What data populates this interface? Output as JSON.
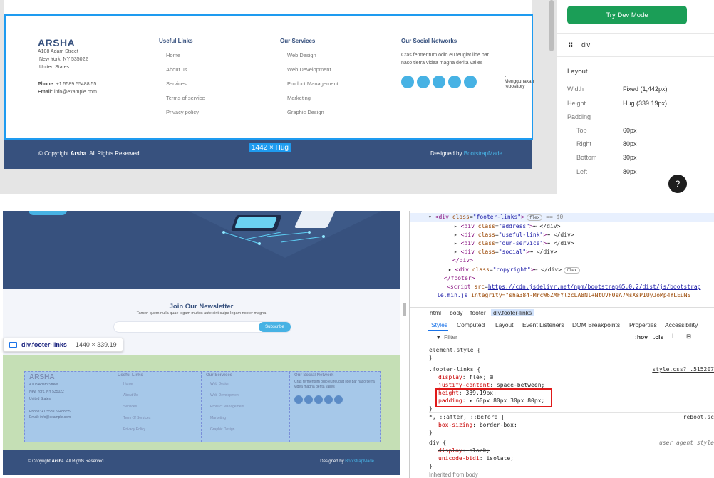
{
  "top_preview": {
    "brand": "ARSHA",
    "address_lines": [
      "A108 Adam Street",
      "New York, NY 535022",
      "United States"
    ],
    "phone_label": "Phone:",
    "phone": "+1 5589 55488 55",
    "email_label": "Email:",
    "email": "info@example.com",
    "useful_links_title": "Useful Links",
    "useful_links": [
      "Home",
      "About us",
      "Services",
      "Terms of service",
      "Privacy policy"
    ],
    "services_title": "Our Services",
    "services": [
      "Web Design",
      "Web Development",
      "Product Management",
      "Marketing",
      "Graphic Design"
    ],
    "social_title": "Our Social Networks",
    "social_text": "Cras fermentum odio eu feugiat lide par naso tierra videa magna derita valies",
    "repo_text": "- Menggunakan repository",
    "copyright_prefix": "© Copyright ",
    "copyright_brand": "Arsha",
    "copyright_suffix": ". All Rights Reserved",
    "designed_by": "Designed by ",
    "designer": "BootstrapMade",
    "size_badge": "1442 × Hug"
  },
  "props_panel": {
    "dev_mode_button": "Try Dev Mode",
    "frame_icon": "⁞⁞",
    "element_label": "div",
    "layout_title": "Layout",
    "rows": [
      {
        "label": "Width",
        "value": "Fixed (1,442px)"
      },
      {
        "label": "Height",
        "value": "Hug (339.19px)"
      },
      {
        "label": "Padding",
        "value": ""
      },
      {
        "label": "Top",
        "value": "60px"
      },
      {
        "label": "Right",
        "value": "80px"
      },
      {
        "label": "Bottom",
        "value": "30px"
      },
      {
        "label": "Left",
        "value": "80px"
      }
    ],
    "help": "?"
  },
  "bottom_preview": {
    "newsletter_title": "Join Our Newsletter",
    "newsletter_sub": "Tamen quem nulla quae legam multos aute sint culpa legam noster magna",
    "subscribe_button": "Subscribe",
    "tooltip_tag": "div.footer-links",
    "tooltip_dims": "1440 × 339.19",
    "hl_brand": "ARSHA",
    "hl_address": [
      "A108 Adam Street",
      "New York, NY 535022",
      "United States"
    ],
    "hl_phone": "Phone: +1 5589 55488 55",
    "hl_email": "Email: info@example.com",
    "hl_useful_title": "Useful Links",
    "hl_useful": [
      "Home",
      "About Us",
      "Services",
      "Term Of Services",
      "Privacy Policy"
    ],
    "hl_services_title": "Our Services",
    "hl_services": [
      "Web Design",
      "Web Development",
      "Product Management",
      "Marketing",
      "Graphic Design"
    ],
    "hl_social_title": "Our Social Network",
    "hl_social_text": "Cras fermentum odio eu feugiat lide par naso tierra videa magna derita valies",
    "copyright_prefix": "© Copyright ",
    "copyright_brand": "Arsha",
    "copyright_suffix": " .All Rights Reserved",
    "designed_by": "Designed by ",
    "designer": "BootstrapMade"
  },
  "devtools": {
    "dom": [
      {
        "pre": "▾ ",
        "tag": "div",
        "cls": "footer-links",
        "post": "",
        "pill": "flex",
        "eq": " == $0"
      },
      {
        "pre": "▸ ",
        "tag": "div",
        "cls": "address",
        "post": "⋯ </div>"
      },
      {
        "pre": "▸ ",
        "tag": "div",
        "cls": "useful-link",
        "post": "⋯ </div>"
      },
      {
        "pre": "▸ ",
        "tag": "div",
        "cls": "our-service",
        "post": "⋯ </div>"
      },
      {
        "pre": "▸ ",
        "tag": "div",
        "cls": "social",
        "post": "⋯ </div>"
      }
    ],
    "dom_close_div": "</div>",
    "dom_copyright": {
      "tag": "div",
      "cls": "copyright",
      "post": "⋯ </div>",
      "pill": "flex"
    },
    "dom_close_footer": "</footer>",
    "script_src": "https://cdn.jsdelivr.net/npm/bootstrap@5.0.2/dist/js/bootstrap",
    "script_src2": "le.min.js",
    "script_integrity": " integrity=\"sha384-MrcW6ZMFYlzcLA8Nl+NtUVF0sA7MsXsP1UyJoMp4YLEuNS",
    "breadcrumbs": [
      "html",
      "body",
      "footer",
      "div.footer-links"
    ],
    "tabs": [
      "Styles",
      "Computed",
      "Layout",
      "Event Listeners",
      "DOM Breakpoints",
      "Properties",
      "Accessibility"
    ],
    "filter_placeholder": "Filter",
    "hov": ":hov",
    "cls": ".cls",
    "element_style": "element.style {",
    "close_brace": "}",
    "rule1_selector": ".footer-links {",
    "rule1_source": "style.css?_.515207",
    "rule1_props": [
      {
        "p": "display",
        "v": "flex;",
        "extra": "⊞"
      },
      {
        "p": "justify-content",
        "v": "space-between;"
      },
      {
        "p": "height",
        "v": "339.19px;"
      },
      {
        "p": "padding",
        "v": "▸ 60px 80px 30px 80px;"
      }
    ],
    "rule2_selector": "*, ::after, ::before {",
    "rule2_source": "_reboot.sc",
    "rule2_props": [
      {
        "p": "box-sizing",
        "v": "border-box;"
      }
    ],
    "rule3_selector": "div {",
    "rule3_source": "user agent style",
    "rule3_props": [
      {
        "p": "display",
        "v": "block;",
        "strike": true
      },
      {
        "p": "unicode-bidi",
        "v": "isolate;"
      }
    ],
    "inherited": "Inherited from body"
  },
  "colors": {
    "brand_blue": "#37517e",
    "accent": "#47b2e4",
    "figma_selection": "#1e9bf0",
    "dev_mode_green": "#1b9e57",
    "highlight_padding": "#c5dfb5",
    "highlight_content": "#a6c8e9",
    "red_box": "#e01a1a"
  }
}
